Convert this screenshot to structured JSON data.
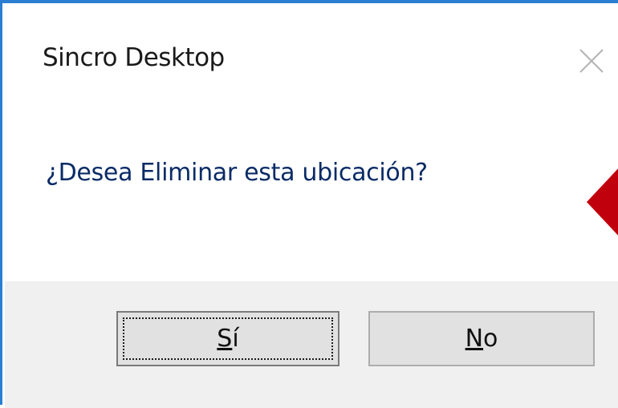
{
  "window": {
    "title": "Sincro Desktop",
    "close_icon": "close-icon",
    "accent_color": "#2b7fd3"
  },
  "message": {
    "text": "¿Desea Eliminar esta ubicación?",
    "color": "#0a2b66"
  },
  "annotation": {
    "icon": "red-arrow-pointer",
    "color": "#c0000c"
  },
  "buttons": {
    "yes": {
      "mnemonic": "S",
      "rest": "í"
    },
    "no": {
      "mnemonic": "N",
      "rest": "o"
    }
  }
}
